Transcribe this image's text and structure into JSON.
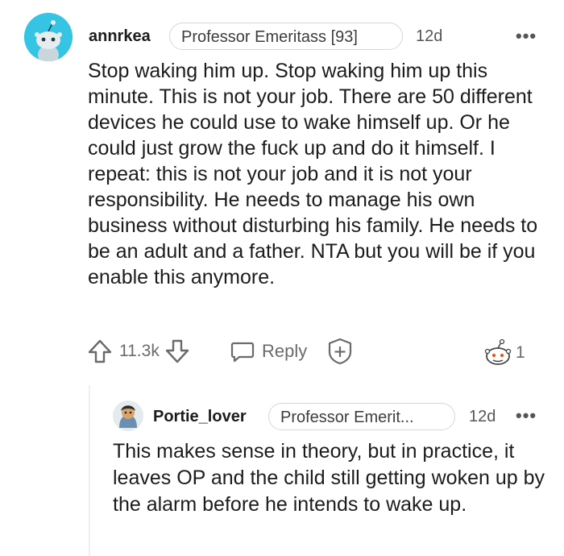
{
  "comment": {
    "username": "annrkea",
    "flair": "Professor Emeritass [93]",
    "time": "12d",
    "more": "•••",
    "body": "Stop waking him up. Stop waking him up this minute. This is not your job. There are 50 different devices he could use to wake himself up. Or he could just grow the fuck up and do it himself. I repeat: this is not your job and it is not your responsibility. He needs to manage his own business without disturbing his family. He needs to be an adult and a father. NTA but you will be if you enable this anymore.",
    "score": "11.3k",
    "reply_label": "Reply",
    "award_count": "1",
    "colors": {
      "avatar_bg": "#35c4e4",
      "text": "#1c1c1c",
      "muted": "#6a6a6a"
    }
  },
  "reply": {
    "username": "Portie_lover",
    "flair": "Professor Emerit...",
    "time": "12d",
    "more": "•••",
    "body": "This makes sense in theory, but in practice, it leaves OP and the child still getting woken up by the alarm before he intends to wake up."
  },
  "icons": [
    "upvote-icon",
    "downvote-icon",
    "reply-bubble-icon",
    "add-award-icon",
    "award-icon",
    "more-icon"
  ]
}
